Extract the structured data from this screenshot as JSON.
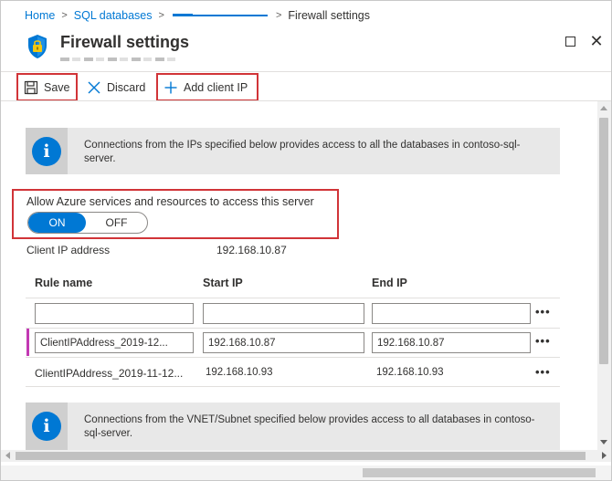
{
  "breadcrumb": {
    "items": [
      "Home",
      "SQL databases"
    ],
    "current": "Firewall settings"
  },
  "header": {
    "title": "Firewall settings"
  },
  "toolbar": {
    "save_label": "Save",
    "discard_label": "Discard",
    "add_client_ip_label": "Add client IP"
  },
  "info_top": {
    "text": "Connections from the IPs specified below provides access to all the databases in contoso-sql-server."
  },
  "azure_services": {
    "label": "Allow Azure services and resources to access this server",
    "on_label": "ON",
    "off_label": "OFF"
  },
  "client_ip": {
    "label": "Client IP address",
    "value": "192.168.10.87"
  },
  "rules_table": {
    "headers": [
      "Rule name",
      "Start IP",
      "End IP"
    ],
    "new_row": {
      "name": "",
      "start": "",
      "end": ""
    },
    "editing_row": {
      "name": "ClientIPAddress_2019-12...",
      "start": "192.168.10.87",
      "end": "192.168.10.87"
    },
    "saved_row": {
      "name": "ClientIPAddress_2019-11-12...",
      "start": "192.168.10.93",
      "end": "192.168.10.93"
    },
    "more_glyph": "•••"
  },
  "info_bottom": {
    "text": "Connections from the VNET/Subnet specified below provides access to all databases in contoso-sql-server."
  },
  "icons": {
    "info": "i",
    "close": "✕"
  },
  "colors": {
    "accent": "#0078d4",
    "highlight_border": "#d13438",
    "row_marker": "#c239b3"
  }
}
